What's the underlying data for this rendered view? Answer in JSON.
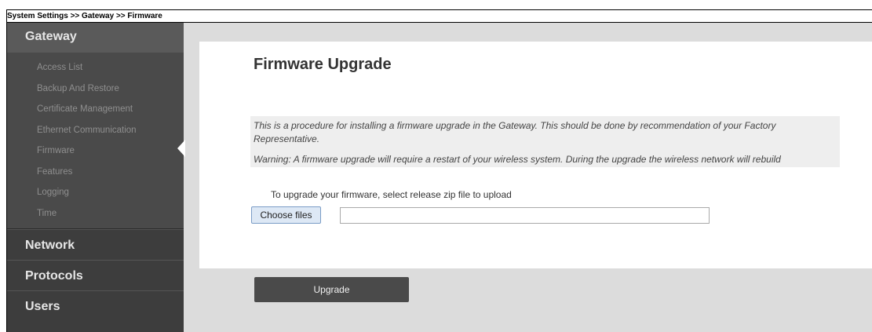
{
  "breadcrumb": "System Settings >> Gateway >> Firmware",
  "sidebar": {
    "active_section": "Gateway",
    "gateway_items": [
      "Access List",
      "Backup And Restore",
      "Certificate Management",
      "Ethernet Communication",
      "Firmware",
      "Features",
      "Logging",
      "Time"
    ],
    "sections": [
      "Network",
      "Protocols",
      "Users"
    ]
  },
  "main": {
    "title": "Firmware Upgrade",
    "info_text": "This is a procedure for installing a firmware upgrade in the Gateway. This should be done by recommendation of your Factory Representative.",
    "warning_text": "Warning: A firmware upgrade will require a restart of your wireless system. During the upgrade the wireless network will rebuild",
    "upload_label": "To upgrade your firmware, select release zip file to upload",
    "choose_button": "Choose files",
    "file_value": "",
    "upgrade_button": "Upgrade"
  },
  "colors": {
    "sidebar_bg": "#3d3d3d",
    "sidebar_active": "#5a5a5a",
    "main_bg": "#dcdcdc",
    "upgrade_button_bg": "#4a4a4a"
  }
}
